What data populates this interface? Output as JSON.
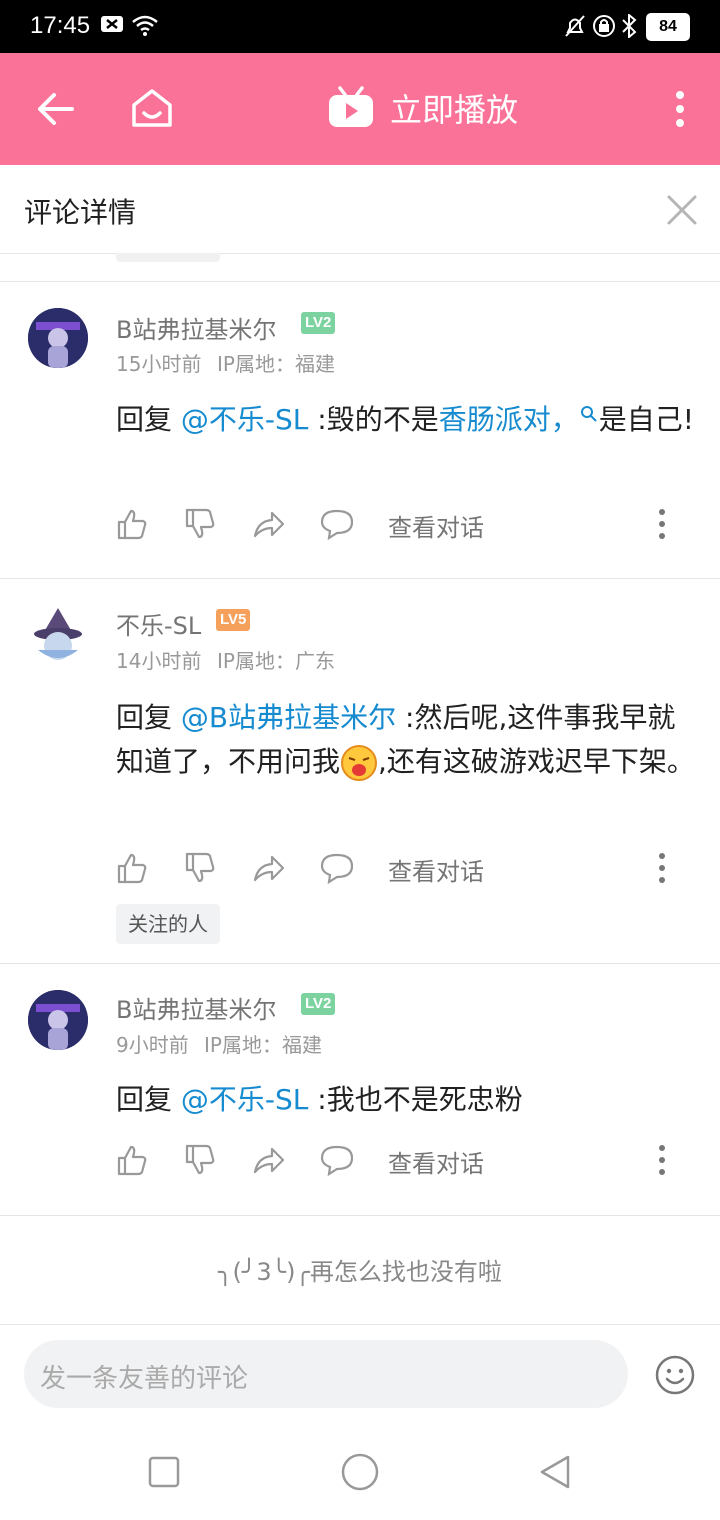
{
  "status_bar": {
    "time": "17:45",
    "battery": "84"
  },
  "app_bar": {
    "title": "立即播放"
  },
  "detail": {
    "title": "评论详情"
  },
  "comments": [
    {
      "username": "B站弗拉基米尔",
      "level": "LV2",
      "time": "15小时前",
      "ip": "IP属地：福建",
      "reply_prefix": "回复 ",
      "mention": "@不乐-SL",
      "text_a": " :毁的不是",
      "keyword": "香肠派对，",
      "text_b": "是自己!",
      "action_talk": "查看对话"
    },
    {
      "username": "不乐-SL",
      "level": "LV5",
      "time": "14小时前",
      "ip": "IP属地：广东",
      "reply_prefix": "回复 ",
      "mention": "@B站弗拉基米尔",
      "text_a": " :然后呢,这件事我早就知道了，不用问我",
      "text_b": ",还有这破游戏迟早下架。",
      "action_talk": "查看对话",
      "tag": "关注的人"
    },
    {
      "username": "B站弗拉基米尔",
      "level": "LV2",
      "time": "9小时前",
      "ip": "IP属地：福建",
      "reply_prefix": "回复 ",
      "mention": "@不乐-SL",
      "text_a": " :我也不是死忠粉",
      "action_talk": "查看对话"
    }
  ],
  "end_text": "╮(╯3╰)╭再怎么找也没有啦",
  "input": {
    "placeholder": "发一条友善的评论"
  },
  "colors": {
    "brand": "#fb7299",
    "link": "#178bcf",
    "lv2": "#7dd3a0",
    "lv5": "#f5a05b"
  }
}
